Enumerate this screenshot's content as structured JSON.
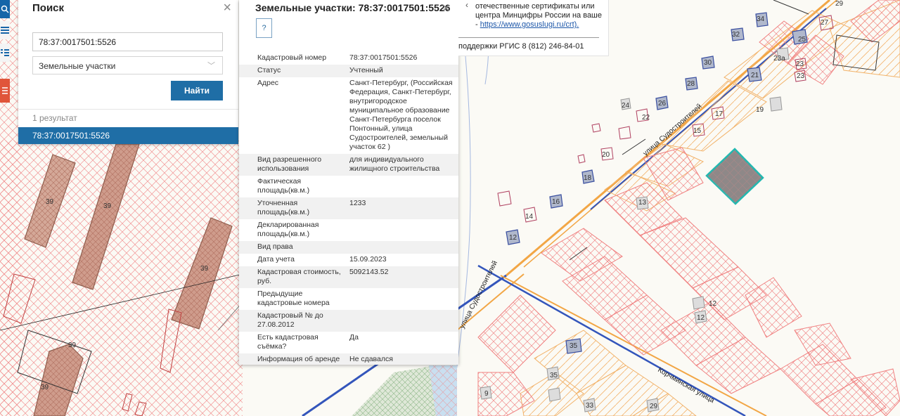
{
  "toolbar": {
    "search_icon": "search-icon",
    "list_icon": "list-icon",
    "legend_icon": "legend-icon",
    "layers_icon": "layers-icon"
  },
  "search": {
    "title": "Поиск",
    "close": "×",
    "query": "78:37:0017501:5526",
    "category": "Земельные участки",
    "button": "Найти",
    "count": "1 результат",
    "results": [
      "78:37:0017501:5526"
    ]
  },
  "info": {
    "title": "Земельные участки: 78:37:0017501:5526",
    "close": "×",
    "help": "?",
    "rows": [
      {
        "key": "Кадастровый номер",
        "value": "78:37:0017501:5526"
      },
      {
        "key": "Статус",
        "value": "Учтенный"
      },
      {
        "key": "Адрес",
        "value": "Санкт-Петербург, (Российская Федерация, Санкт-Петербург, внутригородское муниципальное образование Санкт-Петербурга поселок Понтонный, улица Судостроителей, земельный участок 62 )"
      },
      {
        "key": "Вид разрешенного использования",
        "value": "для индивидуального жилищного строительства"
      },
      {
        "key": "Фактическая площадь(кв.м.)",
        "value": ""
      },
      {
        "key": "Уточненная площадь(кв.м.)",
        "value": "1233"
      },
      {
        "key": "Декларированная площадь(кв.м.)",
        "value": ""
      },
      {
        "key": "Вид права",
        "value": ""
      },
      {
        "key": "Дата учета",
        "value": "15.09.2023"
      },
      {
        "key": "Кадастровая стоимость, руб.",
        "value": "5092143.52"
      },
      {
        "key": "Предыдущие кадастровые номера",
        "value": ""
      },
      {
        "key": "Кадастровый № до 27.08.2012",
        "value": ""
      },
      {
        "key": "Есть кадастровая съёмка?",
        "value": "Да"
      },
      {
        "key": "Информация об аренде",
        "value": "Не сдавался"
      }
    ]
  },
  "notice": {
    "arrow": "‹",
    "line1": "отечественные сертификаты или",
    "line2": "центра Минцифры России на ваше",
    "link_prefix": "- ",
    "link": "https://www.gosuslugi.ru/crt).",
    "phone": "поддержки РГИС 8 (812) 246-84-01"
  },
  "map": {
    "streets": [
      "улица Судостроителей",
      "улица Судостроителей",
      "Корчминская улица"
    ],
    "parcel_labels": [
      "39",
      "39",
      "39",
      "39",
      "39",
      "34",
      "32",
      "27",
      "29",
      "25",
      "23a",
      "23",
      "23",
      "21",
      "30",
      "28",
      "26",
      "24",
      "22",
      "25",
      "17",
      "19",
      "15",
      "20",
      "18",
      "16",
      "14",
      "13",
      "12",
      "12",
      "12",
      "35",
      "35",
      "33",
      "29",
      "9"
    ],
    "colors": {
      "hatch_red": "#f08080",
      "hatch_orange": "#f2b36b",
      "selected": "#20b8b0",
      "road_blue": "#3355bb",
      "road_orange": "#f2a645"
    }
  }
}
